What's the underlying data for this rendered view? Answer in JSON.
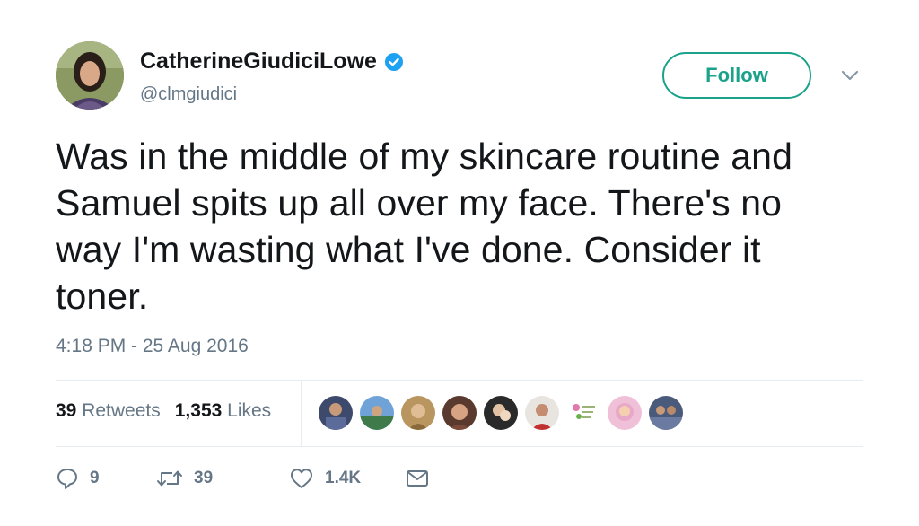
{
  "user": {
    "display_name": "CatherineGiudiciLowe",
    "handle": "@clmgiudici",
    "verified": true
  },
  "follow_label": "Follow",
  "tweet": {
    "line1": "Was in the middle of my skincare routine and",
    "line2": "Samuel spits up all over my face. There's no",
    "line3": "way I'm wasting what I've done. Consider it",
    "line4": "toner.",
    "timestamp": "4:18 PM - 25 Aug 2016"
  },
  "stats": {
    "retweets_count": "39",
    "retweets_label": "Retweets",
    "likes_count": "1,353",
    "likes_label": "Likes"
  },
  "actions": {
    "reply_count": "9",
    "retweet_count": "39",
    "like_count": "1.4K"
  },
  "colors": {
    "accent": "#1aa28a",
    "verified": "#1da1f2",
    "muted": "#657786",
    "text": "#14171a"
  },
  "icons": [
    "verified-badge-icon",
    "chevron-down-icon",
    "reply-icon",
    "retweet-icon",
    "heart-icon",
    "message-icon"
  ]
}
